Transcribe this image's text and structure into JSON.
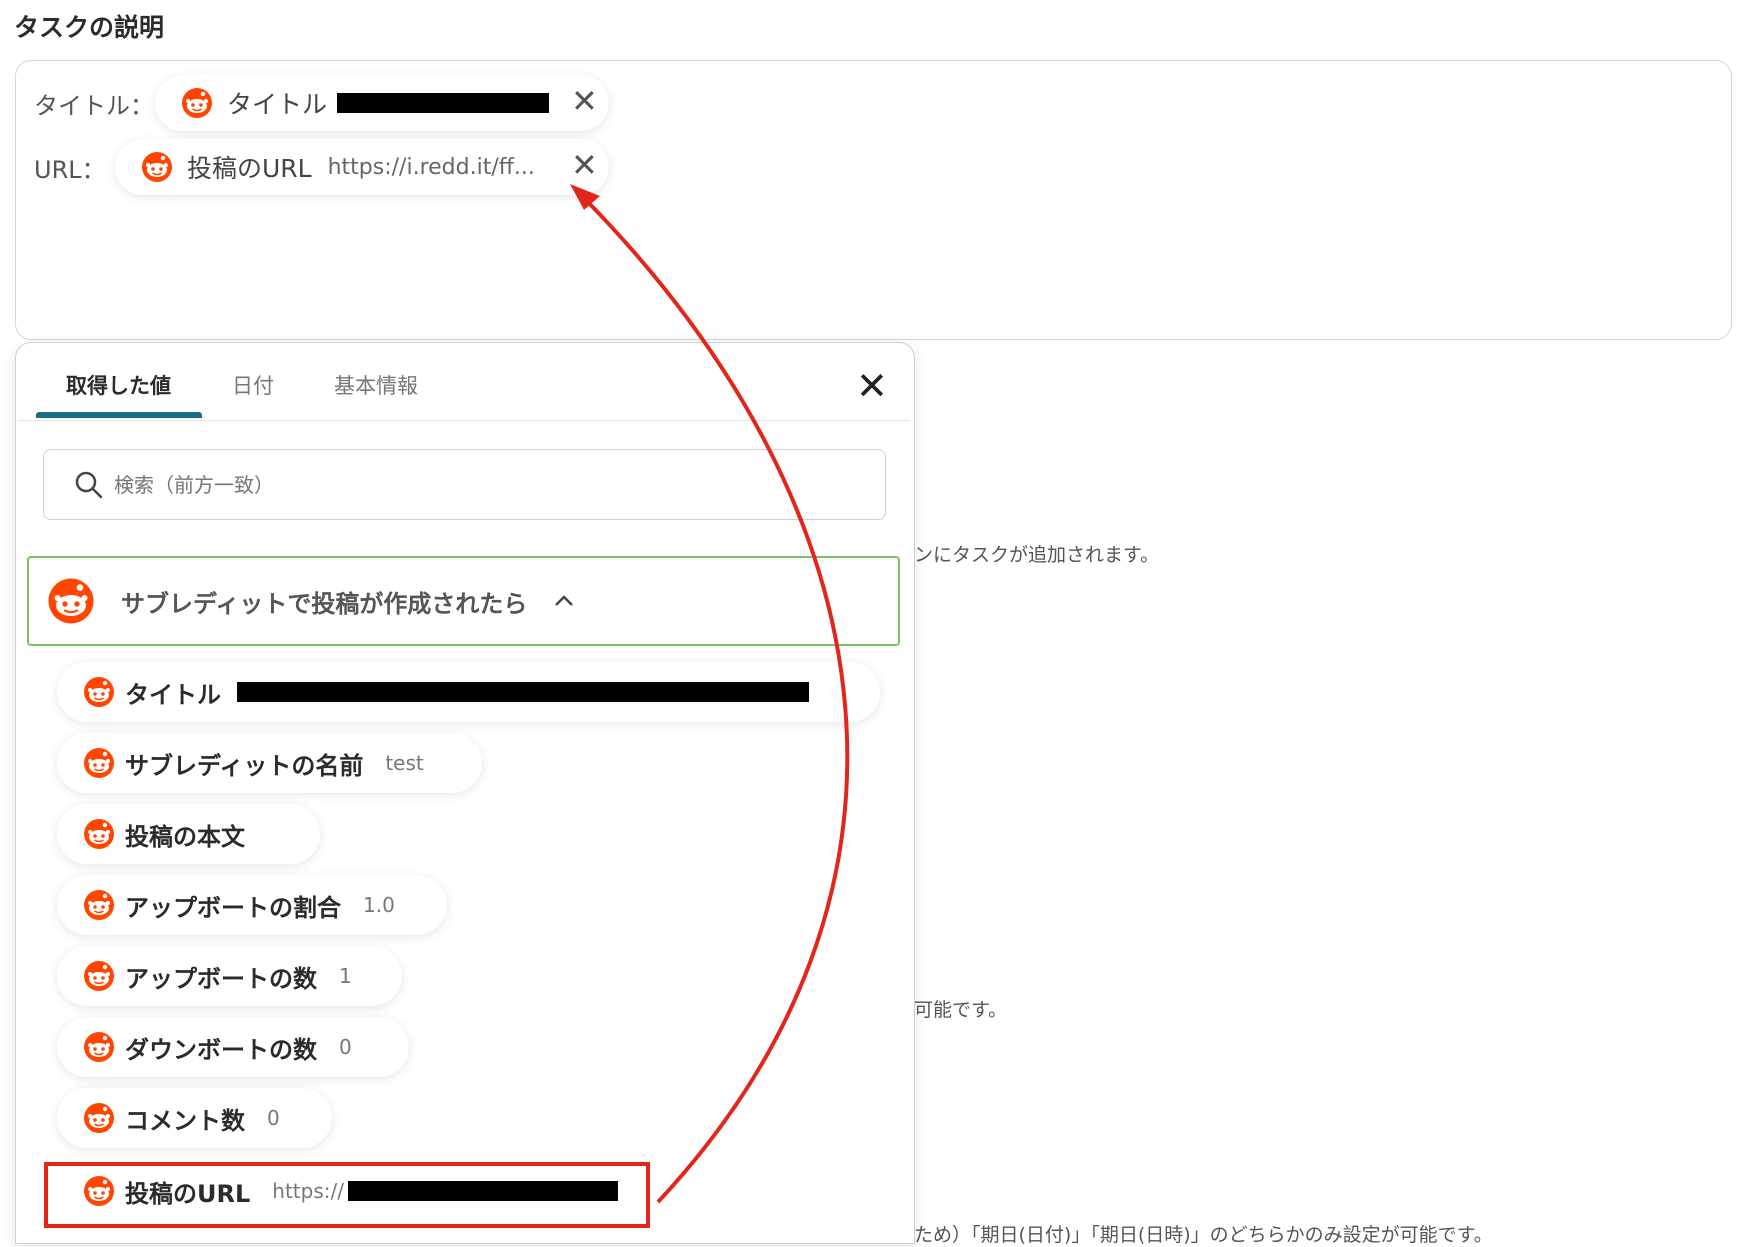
{
  "section_title": "タスクの説明",
  "description": {
    "fields": [
      {
        "label": "タイトル：",
        "chip_name": "タイトル",
        "chip_value": ""
      },
      {
        "label": "URL：",
        "chip_name": "投稿のURL",
        "chip_value": "https://i.redd.it/ff..."
      }
    ]
  },
  "panel": {
    "tabs": [
      "取得した値",
      "日付",
      "基本情報"
    ],
    "active_tab": "取得した値",
    "close_symbol": "✕",
    "search_placeholder": "検索（前方一致）",
    "group": {
      "title": "サブレディットで投稿が作成されたら",
      "expanded": true,
      "items": [
        {
          "name": "タイトル",
          "value": ""
        },
        {
          "name": "サブレディットの名前",
          "value": "test"
        },
        {
          "name": "投稿の本文",
          "value": ""
        },
        {
          "name": "アップボートの割合",
          "value": "1.0"
        },
        {
          "name": "アップボートの数",
          "value": "1"
        },
        {
          "name": "ダウンボートの数",
          "value": "0"
        },
        {
          "name": "コメント数",
          "value": "0"
        },
        {
          "name": "投稿のURL",
          "value": "https://"
        }
      ]
    }
  },
  "background_text": {
    "line1": "ンにタスクが追加されます。",
    "line2": "可能です。",
    "line3": "ため）「期日(日付)」「期日(日時)」のどちらかのみ設定が可能です。"
  },
  "colors": {
    "accent_tab": "#1c6d86",
    "group_border": "#7dc06c",
    "annotation_red": "#e3261c",
    "reddit_orange": "#ff4500"
  },
  "icons": {
    "reddit": "reddit-icon",
    "close": "close-icon",
    "search": "search-icon",
    "chevron": "chevron-up-icon"
  }
}
